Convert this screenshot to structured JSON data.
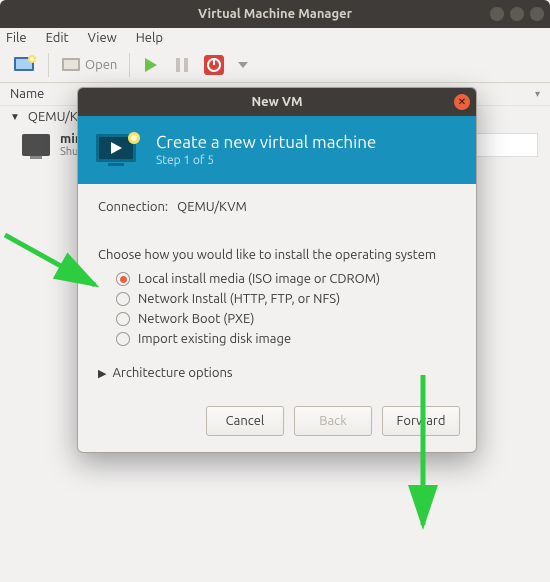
{
  "main": {
    "title": "Virtual Machine Manager",
    "menubar": [
      "File",
      "Edit",
      "View",
      "Help"
    ],
    "toolbar": {
      "open_label": "Open"
    },
    "tree": {
      "header_name": "Name",
      "node": "QEMU/KVM",
      "vm": {
        "name": "min",
        "state": "Shu"
      }
    }
  },
  "dialog": {
    "title": "New VM",
    "header": {
      "title": "Create a new virtual machine",
      "step": "Step 1 of 5"
    },
    "connection": {
      "label": "Connection:",
      "value": "QEMU/KVM"
    },
    "choose_label": "Choose how you would like to install the operating system",
    "options": [
      {
        "label": "Local install media (ISO image or CDROM)",
        "checked": true
      },
      {
        "label": "Network Install (HTTP, FTP, or NFS)",
        "checked": false
      },
      {
        "label": "Network Boot (PXE)",
        "checked": false
      },
      {
        "label": "Import existing disk image",
        "checked": false
      }
    ],
    "arch_label": "Architecture options",
    "buttons": {
      "cancel": "Cancel",
      "back": "Back",
      "forward": "Forward"
    }
  },
  "colors": {
    "accent": "#e9623a",
    "header": "#1892bd",
    "arrow": "#2ecc40"
  }
}
